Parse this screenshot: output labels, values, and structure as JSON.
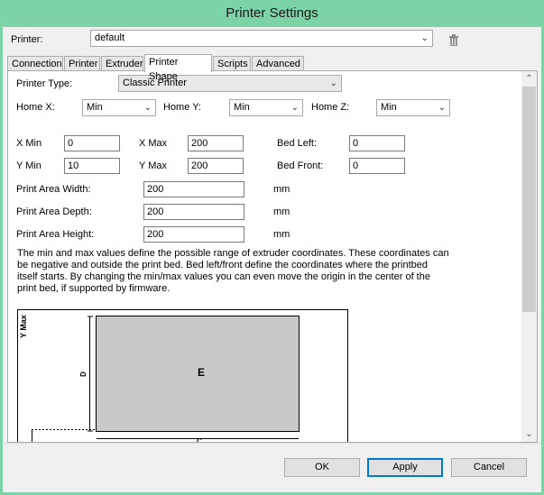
{
  "window": {
    "title": "Printer Settings"
  },
  "printer": {
    "label": "Printer:",
    "value": "default"
  },
  "tabs": [
    {
      "label": "Connection"
    },
    {
      "label": "Printer"
    },
    {
      "label": "Extruder"
    },
    {
      "label": "Printer Shape"
    },
    {
      "label": "Scripts"
    },
    {
      "label": "Advanced"
    }
  ],
  "shape": {
    "printer_type_label": "Printer Type:",
    "printer_type_value": "Classic Printer",
    "home_x_label": "Home X:",
    "home_x_value": "Min",
    "home_y_label": "Home Y:",
    "home_y_value": "Min",
    "home_z_label": "Home Z:",
    "home_z_value": "Min",
    "x_min_label": "X Min",
    "x_min_value": "0",
    "x_max_label": "X Max",
    "x_max_value": "200",
    "bed_left_label": "Bed Left:",
    "bed_left_value": "0",
    "y_min_label": "Y Min",
    "y_min_value": "10",
    "y_max_label": "Y Max",
    "y_max_value": "200",
    "bed_front_label": "Bed Front:",
    "bed_front_value": "0",
    "width_label": "Print Area Width:",
    "width_value": "200",
    "depth_label": "Print Area Depth:",
    "depth_value": "200",
    "height_label": "Print Area Height:",
    "height_value": "200",
    "unit": "mm",
    "description": "The min and max values define the possible range of extruder coordinates. These coordinates can be negative and outside the print bed. Bed left/front define the coordinates where the printbed itself starts. By changing the min/max values you can even move the origin in the center of the print bed, if supported by firmware."
  },
  "diagram": {
    "y_axis_label": "Y Max",
    "d_label": "D",
    "e_label": "E",
    "c_label": "C"
  },
  "buttons": {
    "ok": "OK",
    "apply": "Apply",
    "cancel": "Cancel"
  }
}
